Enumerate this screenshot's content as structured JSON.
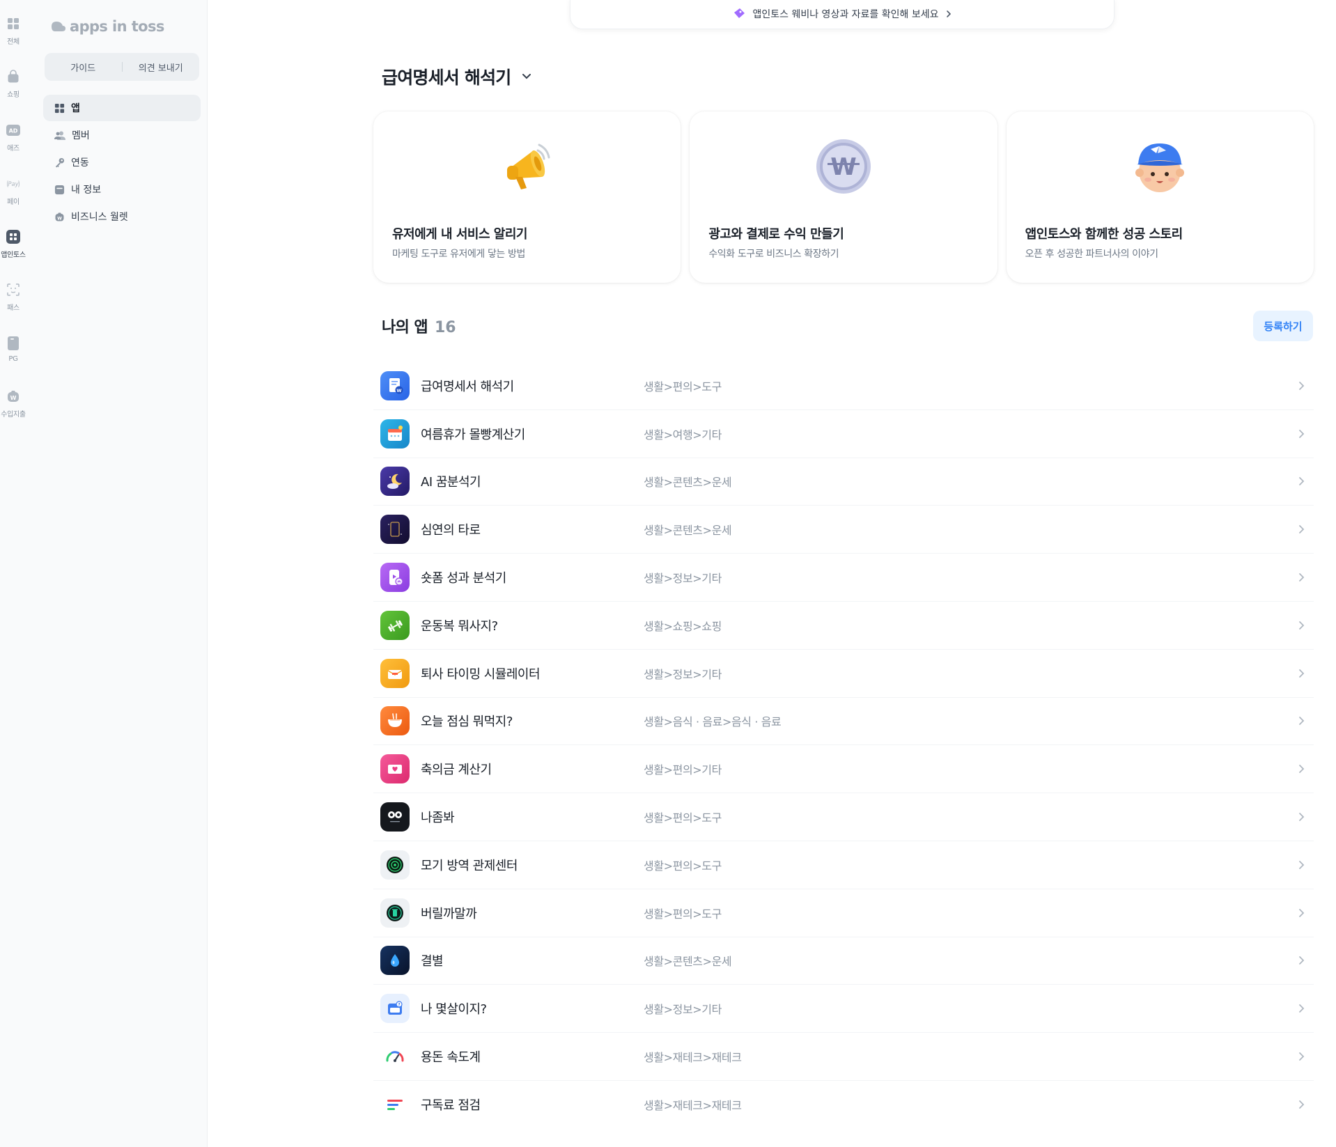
{
  "rail": {
    "items": [
      {
        "label": "전체",
        "icon": "grid-icon"
      },
      {
        "label": "쇼핑",
        "icon": "shopping-bag-icon"
      },
      {
        "label": "애즈",
        "icon": "ad-icon"
      },
      {
        "label": "페이",
        "icon": "pay-icon"
      },
      {
        "label": "앱인토스",
        "icon": "apps-in-toss-icon"
      },
      {
        "label": "패스",
        "icon": "face-id-icon"
      },
      {
        "label": "PG",
        "icon": "card-icon"
      },
      {
        "label": "수입지출",
        "icon": "wallet-icon"
      }
    ]
  },
  "panel": {
    "logo_text": "apps in toss",
    "guide_label": "가이드",
    "feedback_label": "의견 보내기",
    "menu": [
      {
        "label": "앱",
        "icon": "grid-icon"
      },
      {
        "label": "멤버",
        "icon": "members-icon"
      },
      {
        "label": "연동",
        "icon": "key-icon"
      },
      {
        "label": "내 정보",
        "icon": "info-card-icon"
      },
      {
        "label": "비즈니스 월렛",
        "icon": "wallet-icon"
      }
    ]
  },
  "banner": {
    "text": "앱인토스 웨비나 영상과 자료를 확인해 보세요"
  },
  "main": {
    "title": "급여명세서 해석기",
    "cards": [
      {
        "title": "유저에게 내 서비스 알리기",
        "subtitle": "마케팅 도구로 유저에게 닿는 방법",
        "icon": "megaphone-icon"
      },
      {
        "title": "광고와 결제로 수익 만들기",
        "subtitle": "수익화 도구로 비즈니스 확장하기",
        "icon": "won-coin-icon"
      },
      {
        "title": "앱인토스와 함께한 성공 스토리",
        "subtitle": "오픈 후 성공한 파트너사의 이야기",
        "icon": "character-icon"
      }
    ],
    "my_apps_title": "나의 앱",
    "my_apps_count": "16",
    "register_label": "등록하기",
    "apps": [
      {
        "name": "급여명세서 해석기",
        "category": "생활>편의>도구",
        "color": "#3a7bf5"
      },
      {
        "name": "여름휴가 몰빵계산기",
        "category": "생활>여행>기타",
        "color": "#1f9fd6"
      },
      {
        "name": "AI 꿈분석기",
        "category": "생활>콘텐츠>운세",
        "color": "#3b2a8c"
      },
      {
        "name": "심연의 타로",
        "category": "생활>콘텐츠>운세",
        "color": "#1b1640"
      },
      {
        "name": "숏폼 성과 분석기",
        "category": "생활>정보>기타",
        "color": "#9b4de8"
      },
      {
        "name": "운동복 뭐사지?",
        "category": "생활>쇼핑>쇼핑",
        "color": "#4caf2c"
      },
      {
        "name": "퇴사 타이밍 시뮬레이터",
        "category": "생활>정보>기타",
        "color": "#f5a623"
      },
      {
        "name": "오늘 점심 뭐먹지?",
        "category": "생활>음식 · 음료>음식 · 음료",
        "color": "#f26a1b"
      },
      {
        "name": "축의금 계산기",
        "category": "생활>편의>기타",
        "color": "#ec3f85"
      },
      {
        "name": "나좀봐",
        "category": "생활>편의>도구",
        "color": "#15181d"
      },
      {
        "name": "모기 방역 관제센터",
        "category": "생활>편의>도구",
        "color": "#eef1f4"
      },
      {
        "name": "버릴까말까",
        "category": "생활>편의>도구",
        "color": "#eef1f4"
      },
      {
        "name": "결별",
        "category": "생활>콘텐츠>운세",
        "color": "#0d1e3d"
      },
      {
        "name": "나 몇살이지?",
        "category": "생활>정보>기타",
        "color": "#e7f0fe"
      },
      {
        "name": "용돈 속도계",
        "category": "생활>재테크>재테크",
        "color": "#ffffff"
      },
      {
        "name": "구독료 점검",
        "category": "생활>재테크>재테크",
        "color": "#ffffff"
      }
    ]
  }
}
